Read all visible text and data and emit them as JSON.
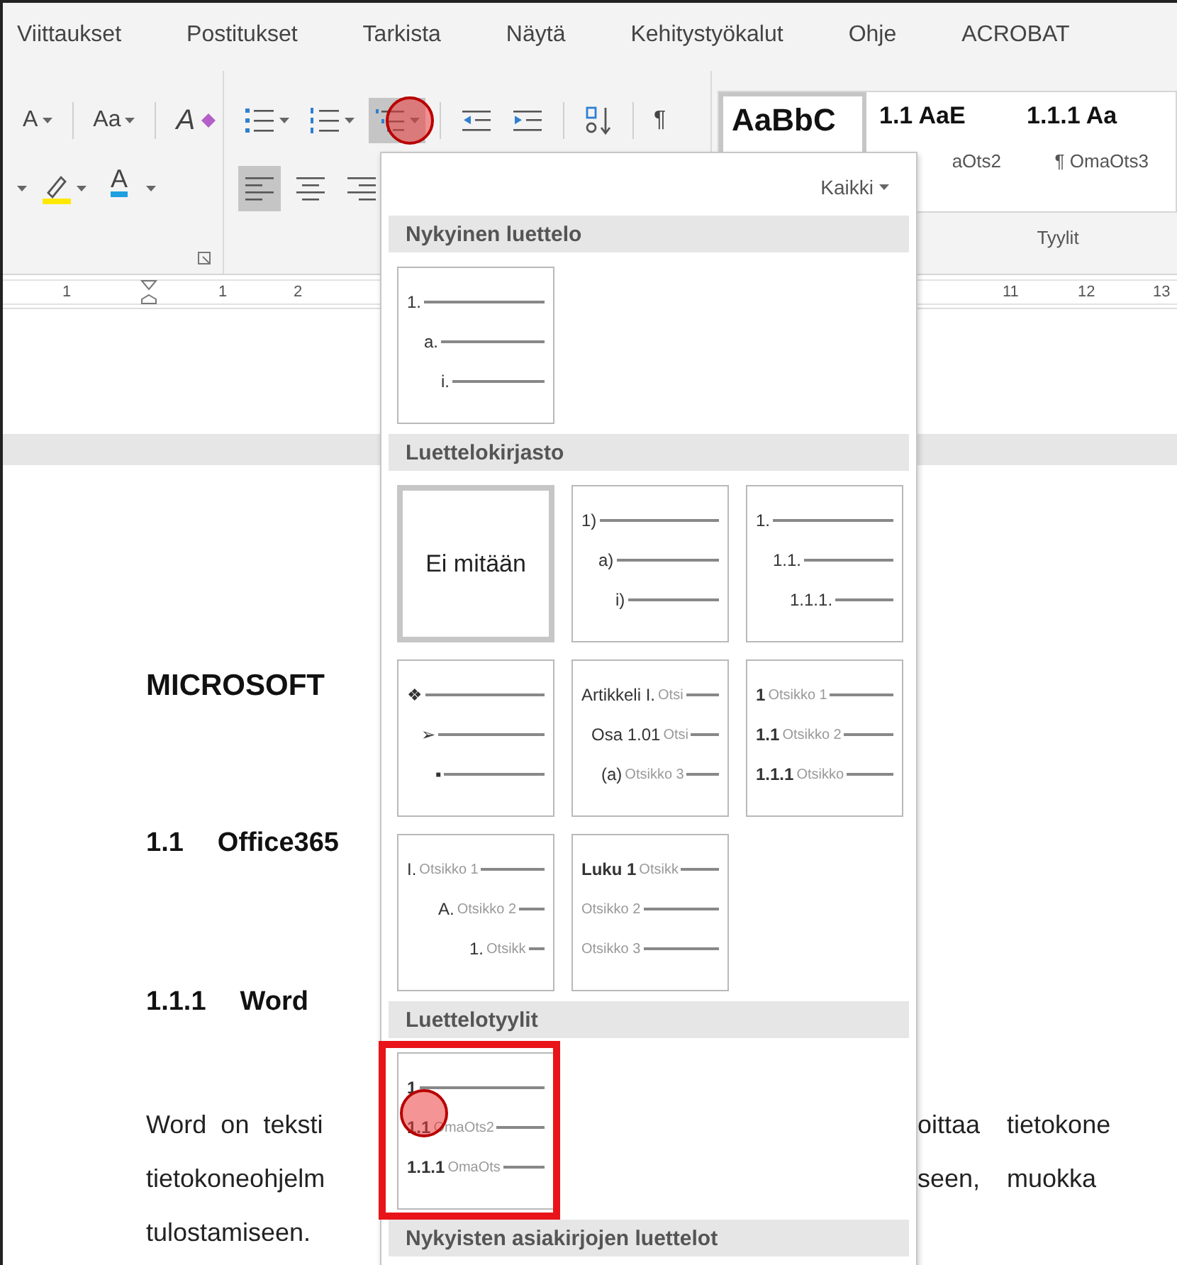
{
  "tabs": [
    {
      "label": "Viittaukset",
      "selected": false
    },
    {
      "label": "Postitukset",
      "selected": false
    },
    {
      "label": "Tarkista",
      "selected": false
    },
    {
      "label": "Näytä",
      "selected": false
    },
    {
      "label": "Kehitystyökalut",
      "selected": false
    },
    {
      "label": "Ohje",
      "selected": false
    },
    {
      "label": "ACROBAT",
      "selected": false
    }
  ],
  "ribbon": {
    "font": {
      "grow_label": "A",
      "case_label": "Aa",
      "clear_label": "A",
      "color_label": "A"
    },
    "paragraph": {
      "tools": [
        {
          "kind": "bullets",
          "selected": false
        },
        {
          "kind": "numbering",
          "selected": false
        },
        {
          "kind": "multilevel",
          "selected": true,
          "annotated": true
        },
        {
          "kind": "outdent",
          "selected": false
        },
        {
          "kind": "indent",
          "selected": false
        },
        {
          "kind": "sort",
          "selected": false
        },
        {
          "kind": "pilcrow",
          "label": "¶",
          "selected": false
        }
      ],
      "align": [
        {
          "kind": "left",
          "selected": true
        },
        {
          "kind": "center",
          "selected": false
        },
        {
          "kind": "right",
          "selected": false
        }
      ]
    },
    "styles": {
      "items": [
        {
          "preview": "AaBbC",
          "selected": true
        },
        {
          "preview": "1.1 AaE",
          "label": "aOts2",
          "selected": false
        },
        {
          "preview": "1.1.1 Aa",
          "label": "¶ OmaOts3",
          "selected": false
        }
      ],
      "group_label": "Tyylit"
    }
  },
  "ruler": {
    "left_numbers": [
      "1",
      "1",
      "2"
    ],
    "right_numbers": [
      "11",
      "12",
      "13"
    ]
  },
  "document": {
    "title": "MICROSOFT",
    "headings": [
      {
        "number": "1.1",
        "text": "Office365"
      },
      {
        "number": "1.1.1",
        "text": "Word"
      }
    ],
    "body_lines": [
      {
        "left": "Word on teksti",
        "right": "oittaa tietokone"
      },
      {
        "left": "tietokoneohjelm",
        "right": "seen, muokka"
      },
      {
        "left": "tulostamiseen."
      }
    ]
  },
  "list_menu": {
    "filter": "Kaikki",
    "sections": [
      {
        "title": "Nykyinen luettelo",
        "items": [
          {
            "kind": "lines",
            "selected": false,
            "annotated": false,
            "levels": [
              {
                "number": "1."
              },
              {
                "number": "a."
              },
              {
                "number": "i."
              }
            ]
          }
        ]
      },
      {
        "title": "Luettelokirjasto",
        "items": [
          {
            "kind": "none",
            "label": "Ei mitään",
            "selected": true,
            "annotated": false
          },
          {
            "kind": "lines",
            "selected": false,
            "annotated": false,
            "levels": [
              {
                "number": "1)"
              },
              {
                "number": "a)"
              },
              {
                "number": "i)"
              }
            ]
          },
          {
            "kind": "lines",
            "selected": false,
            "annotated": false,
            "levels": [
              {
                "number": "1."
              },
              {
                "number": "1.1."
              },
              {
                "number": "1.1.1."
              }
            ]
          },
          {
            "kind": "bullets",
            "selected": false,
            "annotated": false,
            "levels": [
              {
                "number": "❖"
              },
              {
                "number": "➢"
              },
              {
                "number": "▪"
              }
            ]
          },
          {
            "kind": "legal",
            "selected": false,
            "annotated": false,
            "levels": [
              {
                "number": "Artikkeli I.",
                "text": "Otsi"
              },
              {
                "number": "Osa 1.01",
                "text": "Otsi"
              },
              {
                "number": "(a)",
                "text": "Otsikko 3"
              }
            ]
          },
          {
            "kind": "headings",
            "selected": false,
            "annotated": false,
            "levels": [
              {
                "number": "1",
                "text": "Otsikko 1"
              },
              {
                "number": "1.1",
                "text": "Otsikko 2"
              },
              {
                "number": "1.1.1",
                "text": "Otsikko"
              }
            ]
          },
          {
            "kind": "outline",
            "selected": false,
            "annotated": false,
            "levels": [
              {
                "number": "I.",
                "text": "Otsikko 1"
              },
              {
                "number": "A.",
                "text": "Otsikko 2"
              },
              {
                "number": "1.",
                "text": "Otsikk"
              }
            ]
          },
          {
            "kind": "headings",
            "selected": false,
            "annotated": false,
            "levels": [
              {
                "number": "Luku 1",
                "text": "Otsikk"
              },
              {
                "text": "Otsikko 2"
              },
              {
                "text": "Otsikko 3"
              }
            ]
          }
        ]
      },
      {
        "title": "Luettelotyylit",
        "items": [
          {
            "kind": "headings",
            "selected": false,
            "annotated": true,
            "levels": [
              {
                "number": "1"
              },
              {
                "number": "1.1",
                "text": "OmaOts2"
              },
              {
                "number": "1.1.1",
                "text": "OmaOts"
              }
            ]
          }
        ]
      },
      {
        "title": "Nykyisten asiakirjojen luettelot"
      }
    ]
  }
}
